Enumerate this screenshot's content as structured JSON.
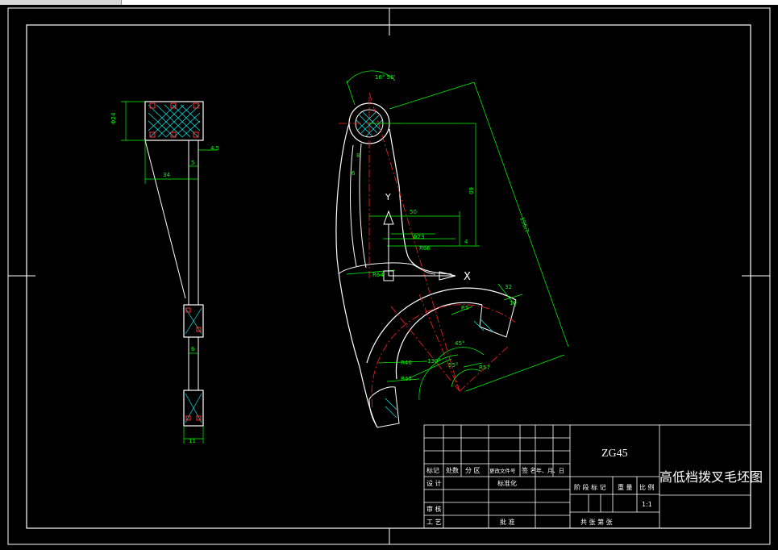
{
  "drawing": {
    "dimensions": {
      "left_view": {
        "height_top": "Φ24",
        "thickness": "4.5",
        "width": "34",
        "rib": "5",
        "web": "6",
        "bottom_width": "11"
      },
      "main_view": {
        "angle_top": "16° 56'",
        "length_60": "60",
        "length_50": "50",
        "length_diag": "156.7",
        "r_a": "Φ23",
        "r_b": "R66",
        "r_c": "R64",
        "r_d": "8",
        "r_e": "6",
        "r_f": "4",
        "w_32": "32",
        "w_10": "10",
        "r_65": "R5",
        "angle_130": "130°",
        "angle_45": "45°",
        "angle_55": "55°",
        "r_46": "R46",
        "r_47": "R47",
        "r_57": "R57"
      },
      "axis_x": "X",
      "axis_y": "Y"
    }
  },
  "title_block": {
    "material": "ZG45",
    "title": "高低档拨叉毛坯图",
    "headers": [
      "标记",
      "处数",
      "分 区",
      "更改文件号",
      "签 名",
      "年、月、日"
    ],
    "row_design": "设 计",
    "row_standard": "标准化",
    "row_review": "审 核",
    "row_process": "工 艺",
    "row_approve": "批 准",
    "stage_labels": [
      "阶 段 标 记",
      "重 量",
      "比 例"
    ],
    "scale": "1:1",
    "sheet_text": "共     张  第     张"
  },
  "colors": {
    "outline": "#ffffff",
    "dimension": "#00ff00",
    "centerline": "#ff0000",
    "hatch": "#00ffff",
    "background": "#000000"
  }
}
